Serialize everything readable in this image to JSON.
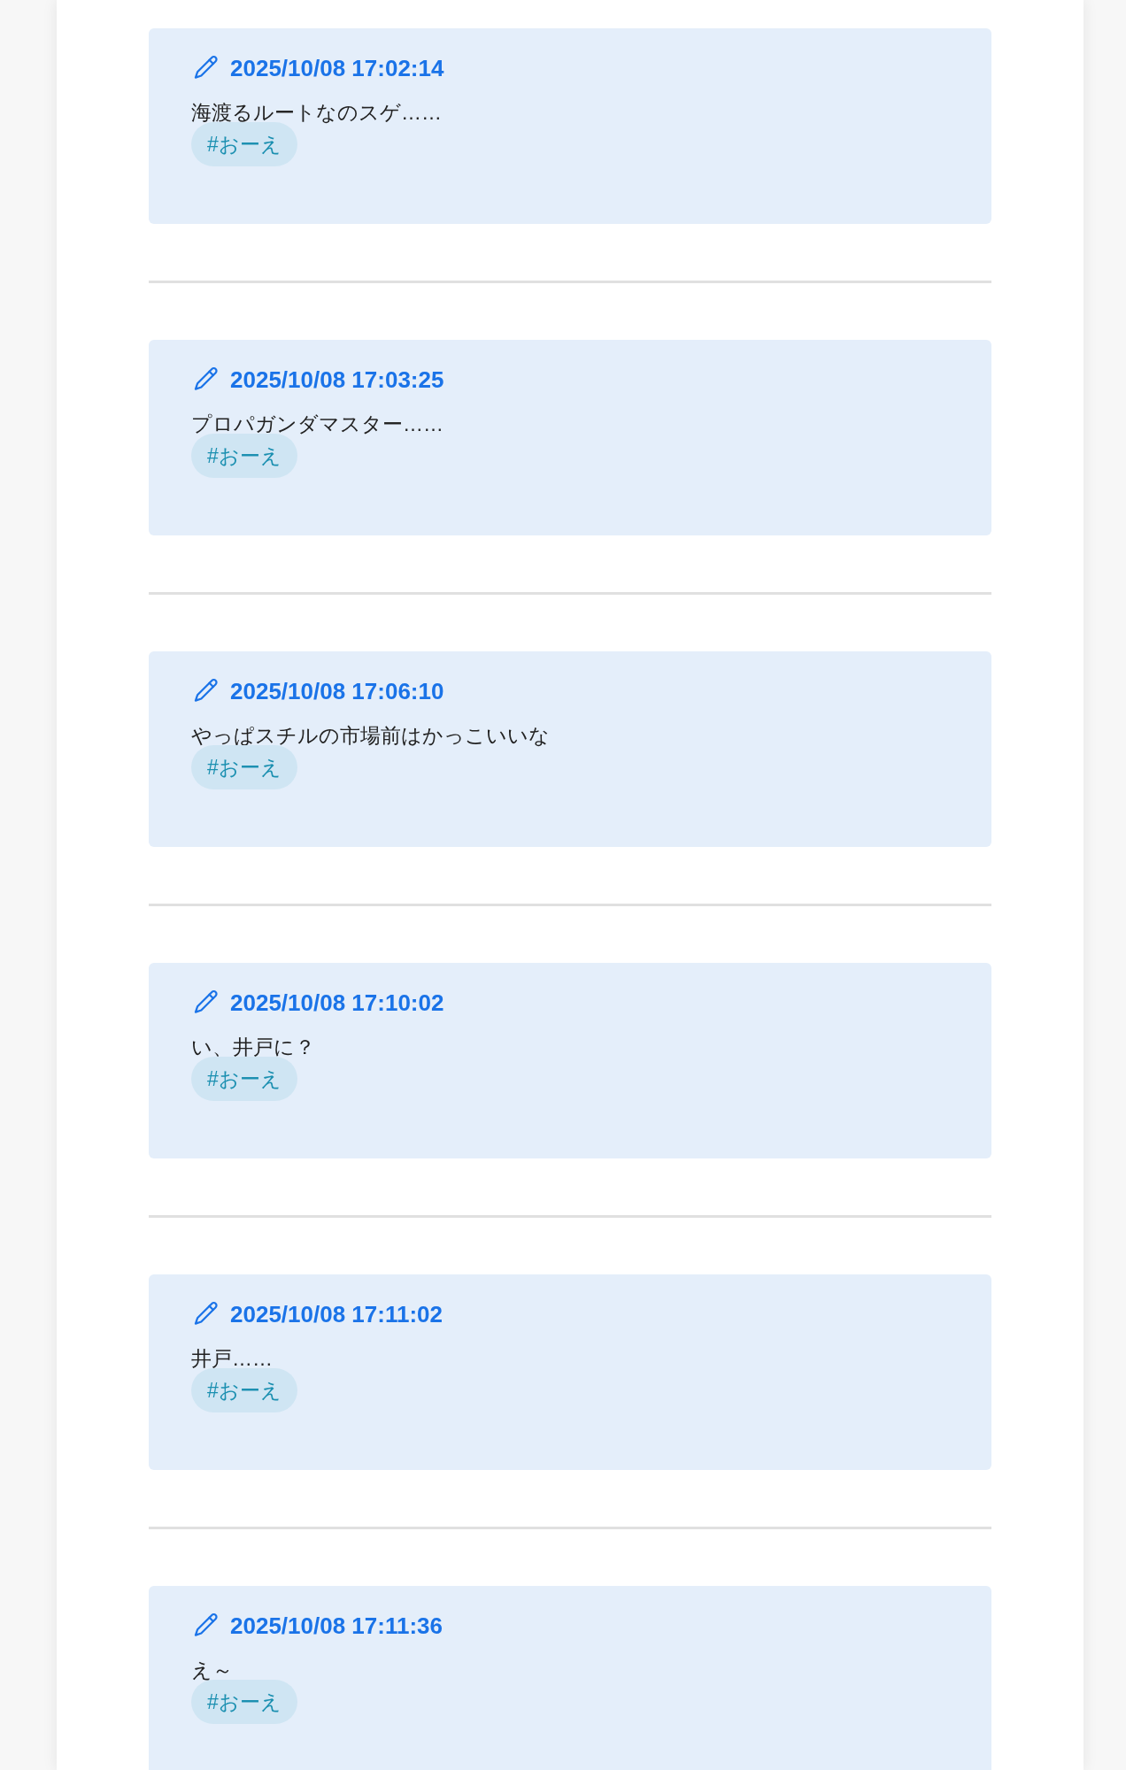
{
  "posts": [
    {
      "timestamp": "2025/10/08 17:02:14",
      "text": "海渡るルートなのスゲ……",
      "tags": [
        "#おーえ"
      ]
    },
    {
      "timestamp": "2025/10/08 17:03:25",
      "text": "プロパガンダマスター……",
      "tags": [
        "#おーえ"
      ]
    },
    {
      "timestamp": "2025/10/08 17:06:10",
      "text": "やっぱスチルの市場前はかっこいいな",
      "tags": [
        "#おーえ"
      ]
    },
    {
      "timestamp": "2025/10/08 17:10:02",
      "text": "い、井戸に？",
      "tags": [
        "#おーえ"
      ]
    },
    {
      "timestamp": "2025/10/08 17:11:02",
      "text": "井戸……",
      "tags": [
        "#おーえ"
      ]
    },
    {
      "timestamp": "2025/10/08 17:11:36",
      "text": "え～",
      "tags": [
        "#おーえ"
      ]
    }
  ]
}
